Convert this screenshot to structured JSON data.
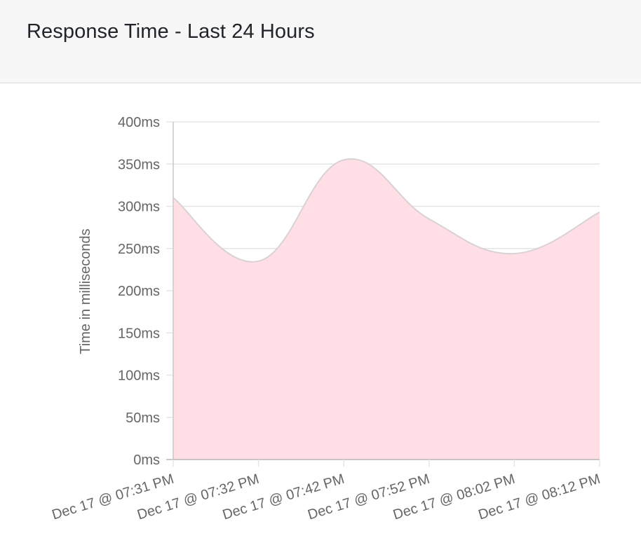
{
  "card": {
    "title": "Response Time - Last 24 Hours"
  },
  "chart_data": {
    "type": "area",
    "title": "",
    "xlabel": "",
    "ylabel": "Time in milliseconds",
    "categories": [
      "Dec 17 @ 07:31 PM",
      "Dec 17 @ 07:32 PM",
      "Dec 17 @ 07:42 PM",
      "Dec 17 @ 07:52 PM",
      "Dec 17 @ 08:02 PM",
      "Dec 17 @ 08:12 PM"
    ],
    "series": [
      {
        "values": [
          310,
          235,
          355,
          285,
          244,
          293
        ]
      }
    ],
    "ylim": [
      0,
      400
    ],
    "yticks": [
      0,
      50,
      100,
      150,
      200,
      250,
      300,
      350,
      400
    ],
    "ytick_suffix": "ms",
    "grid": true,
    "legend": "none",
    "colors": {
      "fill": "#ffdfe5",
      "line": "#d9d2d4",
      "grid": "#e5e5e5",
      "axis": "#c8c8c8",
      "text": "#666666"
    }
  }
}
